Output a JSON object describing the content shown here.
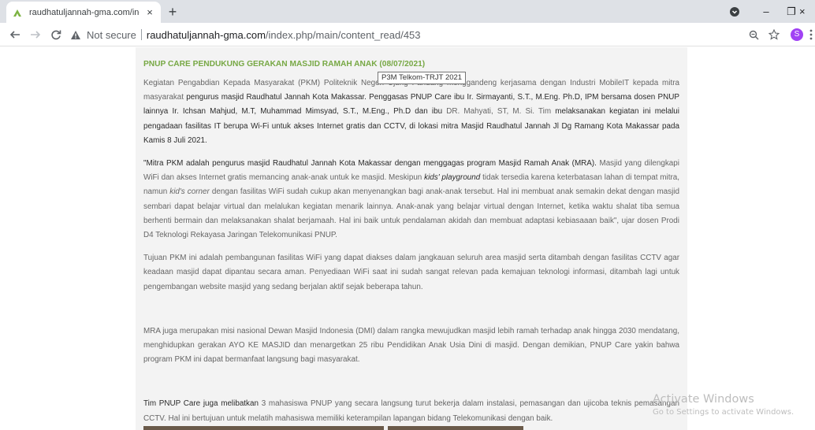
{
  "browser": {
    "tab_title": "raudhatuljannah-gma.com/inde",
    "tab_close": "×",
    "new_tab": "+",
    "security_label": "Not secure",
    "url_host": "raudhatuljannah-gma.com",
    "url_path": "/index.php/main/content_read/453",
    "profile_initial": "S",
    "win_minimize": "–",
    "win_restore": "❐",
    "win_close": "×"
  },
  "article": {
    "headline": "PNUP CARE PENDUKUNG GERAKAN MASJID RAMAH ANAK (08/07/2021)",
    "p1": {
      "a": "Kegiatan Pengabdian Kepada Masyarakat (PKM) Politeknik Negeri Ujung Pandang menggandeng kerjasama dengan Industri MobileIT kepada mitra masyarakat ",
      "b": "pengurus masjid Raudhatul Jannah Kota Makassar. Penggasas PNUP Care ibu Ir. Sirmayanti, S.T., M.Eng. Ph.D, IPM bersama dosen PNUP lainnya Ir. Ichsan Mahjud, M.T, Muhammad Mimsyad, S.T., M.Eng., Ph.D dan ibu ",
      "c": "DR. Mahyati, ST, M. Si. Tim ",
      "d": "melaksanakan kegiatan ini melalui pengadaan fasilitas IT berupa Wi-Fi untuk akses Internet gratis dan CCTV, di lokasi mitra Masjid Raudhatul Jannah Jl Dg Ramang Kota Makassar pada Kamis 8 Juli 2021."
    },
    "p2": {
      "a": "\"Mitra PKM adalah pengurus masjid Raudhatul Jannah Kota Makassar dengan menggagas program Masjid Ramah Anak (MRA). ",
      "b": "Masjid yang dilengkapi WiFi dan akses Internet gratis memancing anak-anak untuk ke masjid. Meskipun ",
      "c": "kids' playground",
      "d": " tidak tersedia karena keterbatasan lahan di tempat mitra, namun ",
      "e": "kid's corner",
      "f": " dengan fasilitas WiFi sudah cukup akan menyenangkan bagi anak-anak tersebut. Hal ini membuat anak semakin dekat dengan masjid sembari dapat belajar virtual dan melalukan kegiatan menarik lainnya. Anak-anak yang belajar virtual dengan Internet, ketika waktu shalat tiba semua berhenti bermain dan melaksanakan shalat berjamaah. Hal ini baik untuk pendalaman akidah dan membuat adaptasi kebiasaaan baik\", ujar dosen Prodi D4 Teknologi Rekayasa Jaringan Telekomunikasi PNUP."
    },
    "p3": "Tujuan PKM ini adalah pembangunan fasilitas WiFi yang dapat diakses dalam jangkauan seluruh area masjid serta ditambah dengan fasilitas CCTV agar keadaan masjid dapat dipantau secara aman. Penyediaan WiFi saat ini sudah sangat relevan pada kemajuan teknologi informasi, ditambah lagi untuk pengembangan website masjid yang sedang berjalan aktif sejak beberapa tahun.",
    "p4": "MRA juga merupakan misi nasional Dewan Masjid Indonesia (DMI) dalam rangka mewujudkan masjid lebih ramah terhadap anak hingga 2030 mendatang, menghidupkan gerakan AYO KE MASJID dan menargetkan 25 ribu Pendidikan Anak Usia Dini di masjid. Dengan demikian, PNUP Care yakin bahwa program PKM ini dapat bermanfaat langsung bagi masyarakat.",
    "p5": {
      "a": "Tim PNUP Care juga melibatkan ",
      "b": "3 mahasiswa PNUP yang secara langsung turut bekerja dalam instalasi, pemasangan dan ujicoba teknis pemasangan CCTV. Hal ini bertujuan untuk melatih mahasiswa memiliki keterampilan lapangan bidang Telekomunikasi dengan baik."
    }
  },
  "tooltip": "P3M Telkom-TRJT 2021",
  "watermark": {
    "title": "Activate Windows",
    "subtitle": "Go to Settings to activate Windows."
  }
}
